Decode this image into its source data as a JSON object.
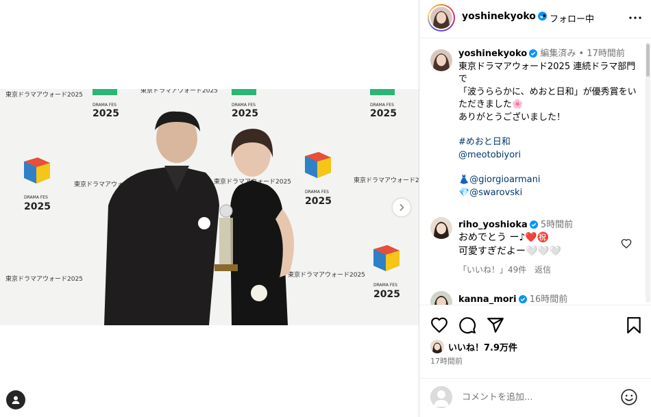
{
  "post": {
    "username": "yoshinekyoko",
    "dot": "•",
    "follow_status": "フォロー中",
    "caption_user": "yoshinekyoko",
    "caption_meta": "編集済み • 17時間前",
    "caption_lines": [
      "東京ドラマアウォード2025 連続ドラマ部門で",
      "「波うららかに、めおと日和」が優秀賞をいただきました🌸",
      "ありがとうございました！"
    ],
    "hashtag": "#めおと日和",
    "mentions": [
      "@meotobiyori"
    ],
    "brand_mentions": [
      {
        "emoji": "👗",
        "handle": "@giorgioarmani"
      },
      {
        "emoji": "💎",
        "handle": "@swarovski"
      }
    ],
    "likes": "いいね！7.9万件",
    "posted": "17時間前"
  },
  "photo": {
    "backdrop_text": "東京ドラマアウォード2025",
    "logo_small": "DRAMA FES",
    "logo_year": "2025"
  },
  "comments": [
    {
      "username": "riho_yoshioka",
      "time": "5時間前",
      "lines": [
        "おめでとう ー♪❤️㊗️",
        "可愛すぎだよー🤍🤍🤍"
      ],
      "likes": "「いいね！」49件",
      "reply": "返信"
    },
    {
      "username": "kanna_mori",
      "time": "16時間前"
    }
  ],
  "add_comment": {
    "placeholder": "コメントを追加..."
  },
  "colors": {
    "verified": "#0095f6",
    "link": "#00376b",
    "logo_red": "#e94e3c",
    "logo_yellow": "#f5c518",
    "logo_green": "#2bb673",
    "logo_blue": "#2f80c7"
  },
  "icons": [
    "more-icon",
    "heart-icon",
    "comment-icon",
    "share-icon",
    "bookmark-icon",
    "emoji-icon",
    "next-arrow-icon",
    "user-tag-icon",
    "verified-icon"
  ]
}
